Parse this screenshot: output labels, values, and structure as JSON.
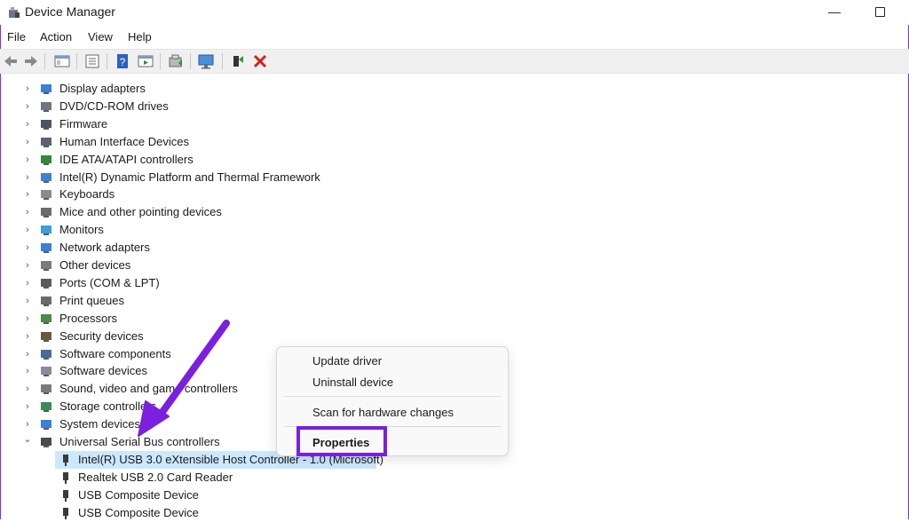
{
  "window": {
    "title": "Device Manager",
    "minimize_glyph": "—",
    "icons": {
      "app": "device-manager-icon",
      "minimize": "minimize-icon",
      "maximize": "maximize-icon"
    }
  },
  "menu": {
    "items": [
      "File",
      "Action",
      "View",
      "Help"
    ]
  },
  "toolbar": {
    "buttons": [
      "back-icon",
      "forward-icon",
      "show-hide-console-tree-icon",
      "properties-icon",
      "help-icon",
      "action-pane-icon",
      "update-driver-icon",
      "scan-hardware-icon",
      "enable-device-icon",
      "uninstall-icon"
    ]
  },
  "tree": {
    "categories": [
      {
        "label": "Display adapters",
        "icon": "display-adapter-icon"
      },
      {
        "label": "DVD/CD-ROM drives",
        "icon": "dvd-drive-icon"
      },
      {
        "label": "Firmware",
        "icon": "firmware-icon"
      },
      {
        "label": "Human Interface Devices",
        "icon": "hid-icon"
      },
      {
        "label": "IDE ATA/ATAPI controllers",
        "icon": "ide-controller-icon"
      },
      {
        "label": "Intel(R) Dynamic Platform and Thermal Framework",
        "icon": "thermal-framework-icon"
      },
      {
        "label": "Keyboards",
        "icon": "keyboard-icon"
      },
      {
        "label": "Mice and other pointing devices",
        "icon": "mouse-icon"
      },
      {
        "label": "Monitors",
        "icon": "monitor-icon"
      },
      {
        "label": "Network adapters",
        "icon": "network-adapter-icon"
      },
      {
        "label": "Other devices",
        "icon": "other-devices-icon"
      },
      {
        "label": "Ports (COM & LPT)",
        "icon": "port-icon"
      },
      {
        "label": "Print queues",
        "icon": "printer-icon"
      },
      {
        "label": "Processors",
        "icon": "processor-icon"
      },
      {
        "label": "Security devices",
        "icon": "security-device-icon"
      },
      {
        "label": "Software components",
        "icon": "software-component-icon"
      },
      {
        "label": "Software devices",
        "icon": "software-device-icon"
      },
      {
        "label": "Sound, video and game controllers",
        "icon": "sound-icon"
      },
      {
        "label": "Storage controllers",
        "icon": "storage-controller-icon"
      },
      {
        "label": "System devices",
        "icon": "system-device-icon"
      },
      {
        "label": "Universal Serial Bus controllers",
        "icon": "usb-icon",
        "expanded": true
      }
    ],
    "usb_children": [
      {
        "label": "Intel(R) USB 3.0 eXtensible Host Controller - 1.0 (Microsoft)",
        "selected": true
      },
      {
        "label": "Realtek USB 2.0 Card Reader"
      },
      {
        "label": "USB Composite Device"
      },
      {
        "label": "USB Composite Device"
      }
    ],
    "expander_collapsed": "›",
    "expander_expanded": "⌄"
  },
  "context_menu": {
    "update_driver": "Update driver",
    "uninstall_device": "Uninstall device",
    "scan_hardware": "Scan for hardware changes",
    "properties": "Properties"
  },
  "colors": {
    "annotation": "#7b1fe0",
    "selection": "#cce8ff"
  }
}
